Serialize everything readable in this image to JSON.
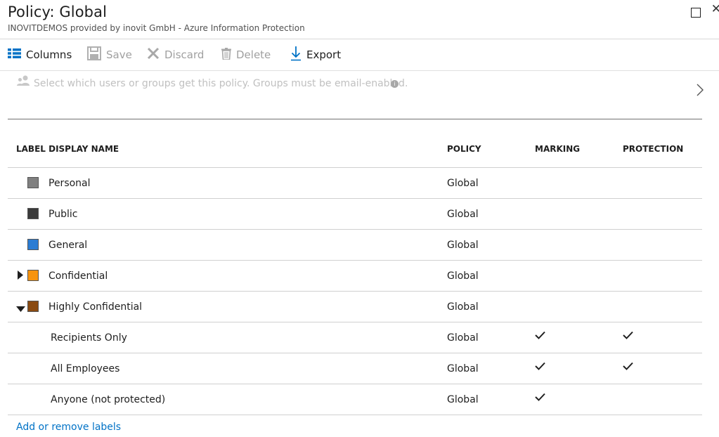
{
  "header": {
    "title": "Policy: Global",
    "subtitle": "INOVITDEMOS provided by inovit GmbH - Azure Information Protection"
  },
  "toolbar": {
    "columns": "Columns",
    "save": "Save",
    "discard": "Discard",
    "delete": "Delete",
    "export": "Export"
  },
  "scope": {
    "placeholder": "Select which users or groups get this policy. Groups must be email-enabled."
  },
  "table": {
    "headers": {
      "label": "LABEL DISPLAY NAME",
      "policy": "POLICY",
      "marking": "MARKING",
      "protection": "PROTECTION"
    },
    "rows": [
      {
        "name": "Personal",
        "policy": "Global",
        "color": "#808080",
        "marking": false,
        "protection": false
      },
      {
        "name": "Public",
        "policy": "Global",
        "color": "#3a3a3a",
        "marking": false,
        "protection": false
      },
      {
        "name": "General",
        "policy": "Global",
        "color": "#2b7cd3",
        "marking": false,
        "protection": false
      },
      {
        "name": "Confidential",
        "policy": "Global",
        "color": "#f7940f",
        "marking": false,
        "protection": false,
        "expander": "collapsed"
      },
      {
        "name": "Highly Confidential",
        "policy": "Global",
        "color": "#8a4b13",
        "marking": false,
        "protection": false,
        "expander": "expanded"
      },
      {
        "name": "Recipients Only",
        "policy": "Global",
        "marking": true,
        "protection": true,
        "child": true
      },
      {
        "name": "All Employees",
        "policy": "Global",
        "marking": true,
        "protection": true,
        "child": true
      },
      {
        "name": "Anyone (not protected)",
        "policy": "Global",
        "marking": true,
        "protection": false,
        "child": true
      }
    ]
  },
  "footer": {
    "add_remove_labels": "Add or remove labels"
  },
  "colors": {
    "accent": "#0072c6",
    "text": "#1e1e1e",
    "disabled": "#a0a0a0"
  }
}
